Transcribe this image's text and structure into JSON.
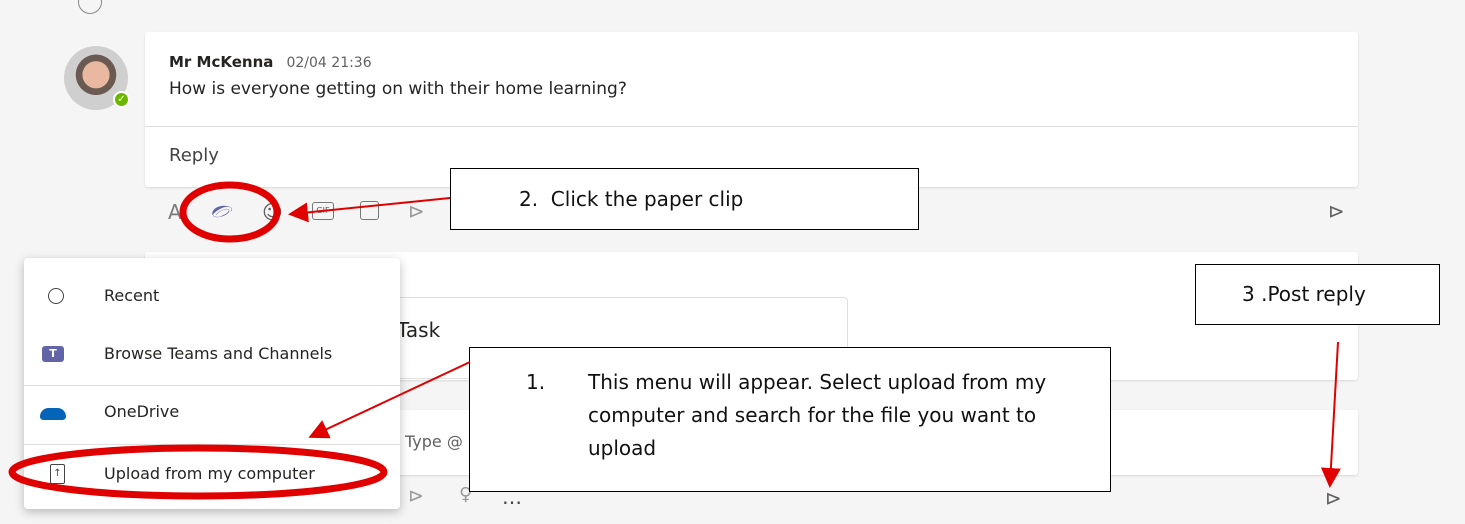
{
  "post": {
    "author": "Mr McKenna",
    "time": "02/04 21:36",
    "message": "How is everyone getting on with their home learning?",
    "reply_placeholder": "Reply"
  },
  "second_post": {
    "title_fragment": "Task"
  },
  "compose": {
    "placeholder_fragment": "Type @",
    "more_label": "…"
  },
  "attach_menu": {
    "items": [
      {
        "label": "Recent",
        "icon": "clock-icon"
      },
      {
        "label": "Browse Teams and Channels",
        "icon": "teams-icon"
      },
      {
        "label": "OneDrive",
        "icon": "onedrive-icon"
      },
      {
        "label": "Upload from my computer",
        "icon": "upload-file-icon"
      }
    ]
  },
  "annotations": {
    "step1_num": "1.",
    "step1_text": "This menu will appear. Select upload from my computer and search for the file you want to upload",
    "step2_text": "2.  Click the paper clip",
    "step3_text": "3 .Post reply"
  },
  "colors": {
    "annotation_red": "#e00000",
    "teams_purple": "#6264a7",
    "onedrive_blue": "#0364b8"
  }
}
